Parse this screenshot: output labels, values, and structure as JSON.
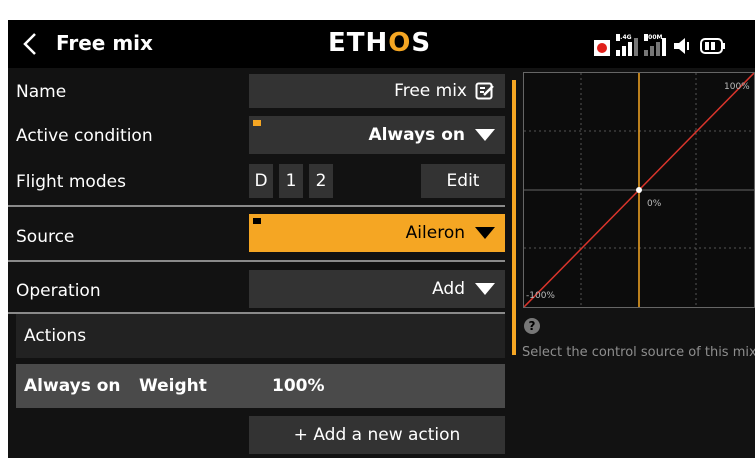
{
  "header": {
    "title": "Free mix",
    "logo_main": "ETH",
    "logo_accent": "O",
    "logo_tail": "S",
    "rx_label_1": "2.4G",
    "rx_label_2": "900M"
  },
  "form": {
    "name_label": "Name",
    "name_value": "Free mix",
    "active_label": "Active condition",
    "active_value": "Always on",
    "flight_modes_label": "Flight modes",
    "flight_modes": [
      "D",
      "1",
      "2"
    ],
    "edit_label": "Edit",
    "source_label": "Source",
    "source_value": "Aileron",
    "operation_label": "Operation",
    "operation_value": "Add"
  },
  "actions": {
    "header": "Actions",
    "row": {
      "condition": "Always on",
      "param": "Weight",
      "value": "100%"
    },
    "add_label": "+ Add a new action"
  },
  "graph": {
    "top_label": "100%",
    "center_label": "0%",
    "bottom_label": "-100%",
    "line_color": "#d9342b",
    "cursor_color": "#f5a623"
  },
  "help": {
    "icon": "?",
    "text": "Select the control source of this mix"
  },
  "colors": {
    "accent": "#f5a623",
    "field": "#333333",
    "background": "#121212"
  }
}
